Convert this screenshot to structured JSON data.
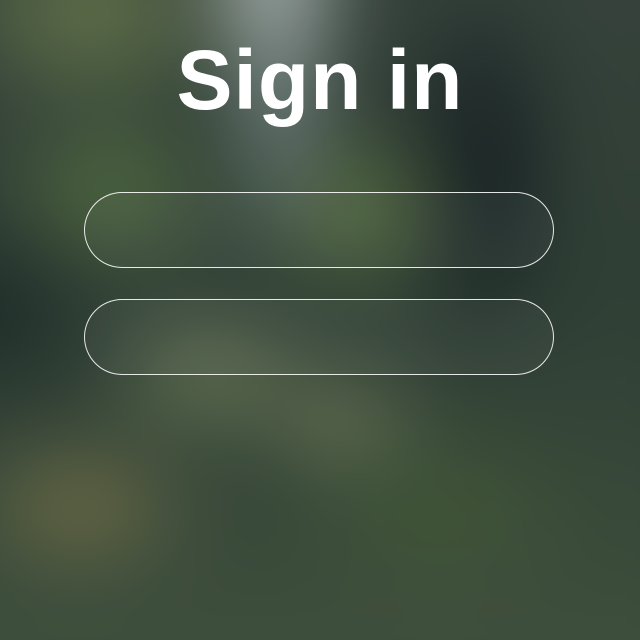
{
  "page": {
    "title": "Sign in"
  },
  "fields": [
    {
      "value": "",
      "placeholder": ""
    },
    {
      "value": "",
      "placeholder": ""
    }
  ]
}
